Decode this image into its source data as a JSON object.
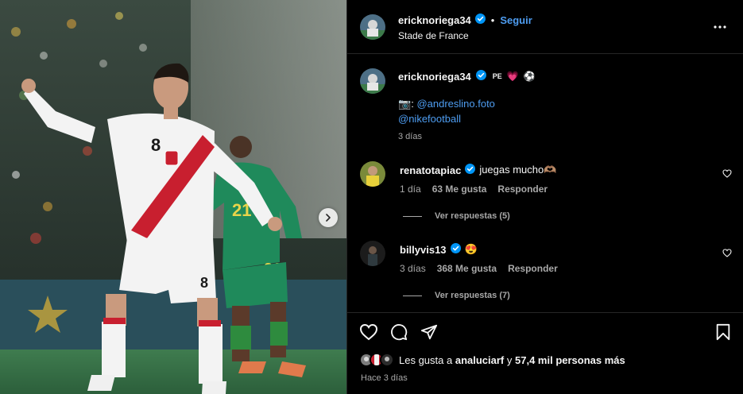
{
  "post": {
    "author": "ericknoriega34",
    "follow_label": "Seguir",
    "separator": "•",
    "location": "Stade de France"
  },
  "caption": {
    "author": "ericknoriega34",
    "flag_text": "PE",
    "emoji_heart": "💗",
    "emoji_ball": "⚽",
    "camera_emoji": "📷",
    "colon": ":",
    "mention_1": "@andreslino.foto",
    "mention_2": "@nikefootball",
    "time": "3 días"
  },
  "comments": [
    {
      "user": "renatotapiac",
      "text": "juegas mucho🫶🏽",
      "time": "1 día",
      "likes": "63 Me gusta",
      "reply_label": "Responder",
      "view_replies": "Ver respuestas (5)"
    },
    {
      "user": "billyvis13",
      "text": "😍",
      "time": "3 días",
      "likes": "368 Me gusta",
      "reply_label": "Responder",
      "view_replies": "Ver respuestas (7)"
    }
  ],
  "likes": {
    "prefix": "Les gusta a",
    "user": "analuciarf",
    "joiner": "y",
    "others": "57,4 mil personas más"
  },
  "posted_ago": "Hace 3 días",
  "icons": {
    "more": "more-horizontal-icon",
    "verified": "verified-badge-icon",
    "like": "heart-outline-icon",
    "comment": "comment-bubble-icon",
    "share": "paper-plane-icon",
    "save": "bookmark-icon",
    "next": "chevron-right-icon"
  },
  "colors": {
    "link": "#4e9df1",
    "muted": "#a8a8a8",
    "verified": "#0095f6"
  }
}
